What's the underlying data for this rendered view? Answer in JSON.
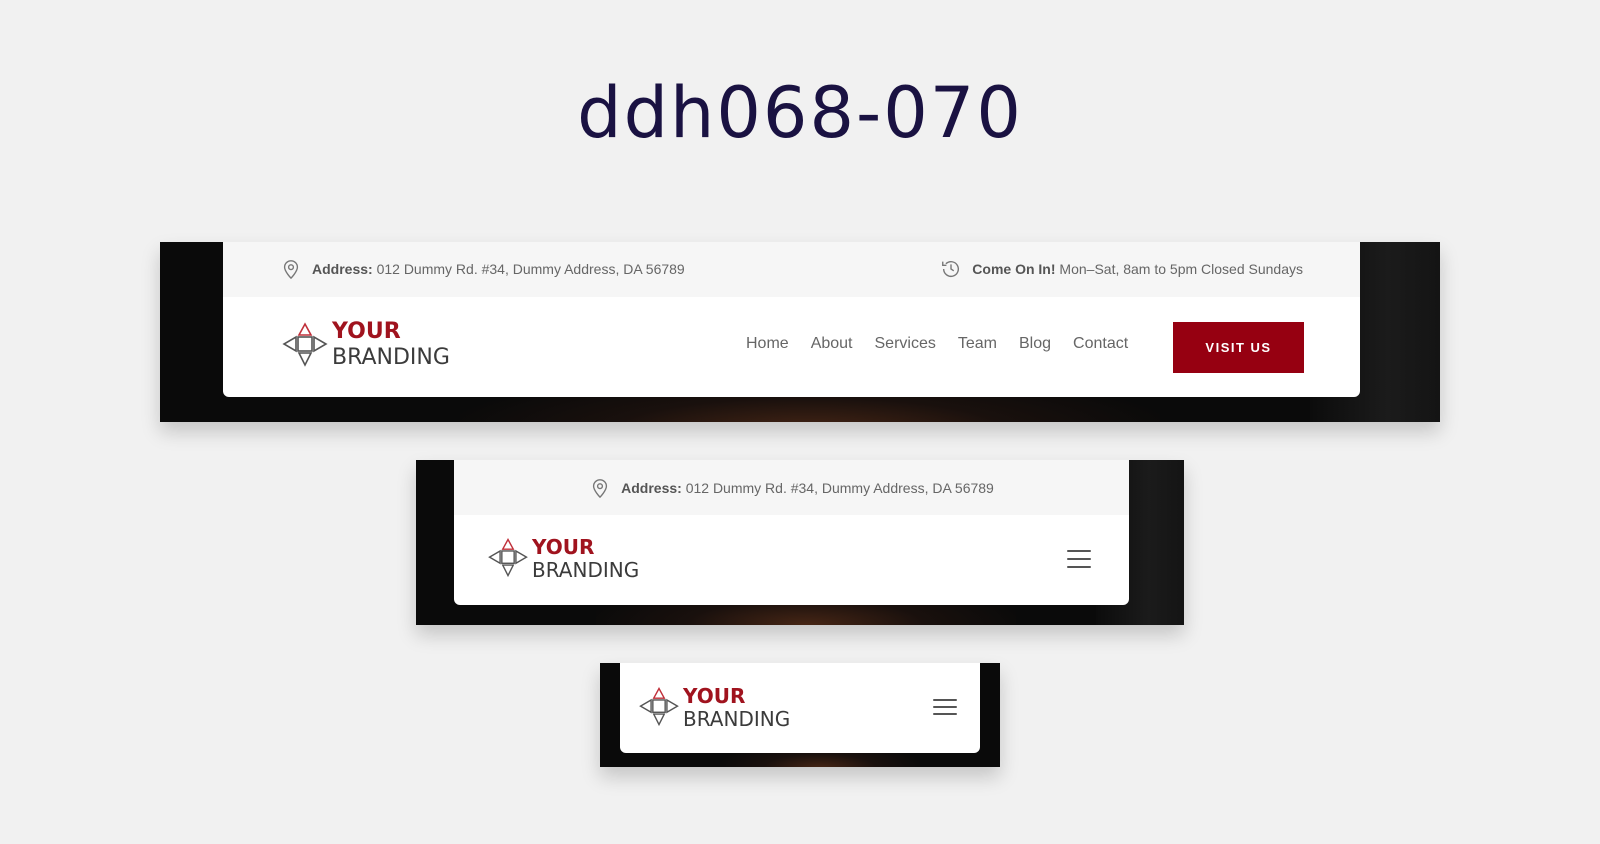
{
  "page": {
    "title": "ddh068-070"
  },
  "brand": {
    "line1": "YOUR",
    "line2": "BRANDING",
    "accent": "#a0131e"
  },
  "topbar": {
    "address_label": "Address:",
    "address_value": "012 Dummy Rd. #34, Dummy Address, DA 56789",
    "hours_label": "Come On In!",
    "hours_value": "Mon–Sat, 8am to 5pm Closed Sundays",
    "address_icon": "map-pin-icon",
    "hours_icon": "clock-history-icon"
  },
  "nav": {
    "items": [
      {
        "label": "Home"
      },
      {
        "label": "About"
      },
      {
        "label": "Services"
      },
      {
        "label": "Team"
      },
      {
        "label": "Blog"
      },
      {
        "label": "Contact"
      }
    ]
  },
  "cta": {
    "label": "VISIT US",
    "color": "#960011"
  },
  "menu_icon": "hamburger-menu-icon"
}
